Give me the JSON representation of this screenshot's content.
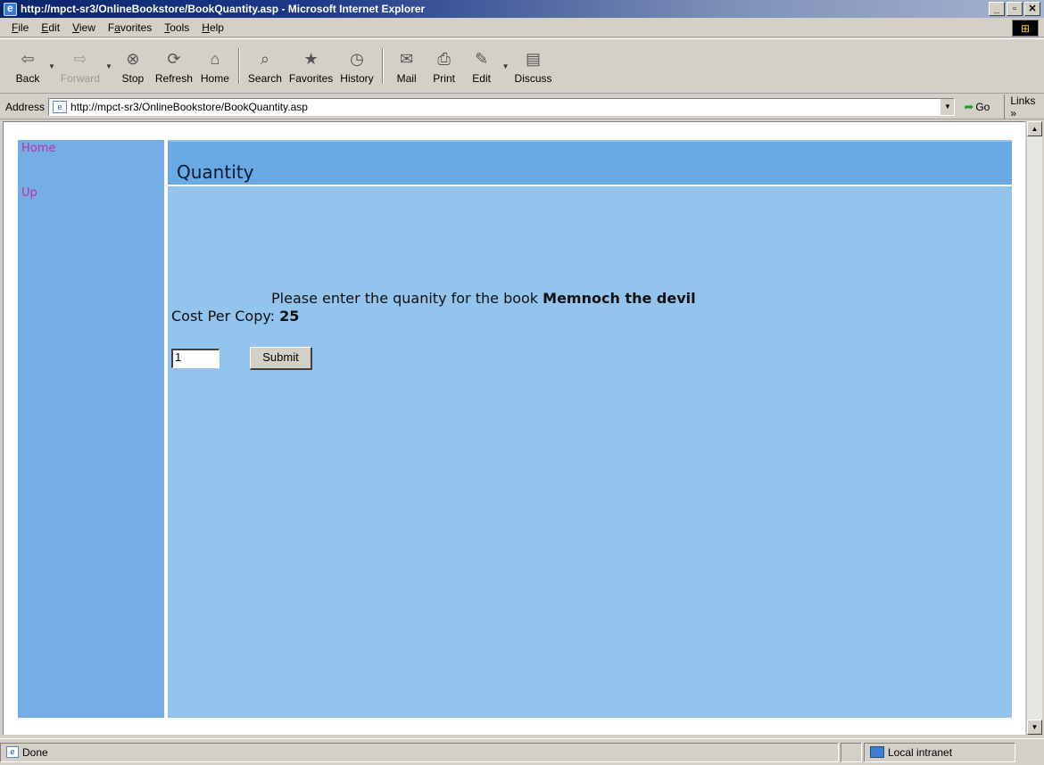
{
  "window": {
    "title": "http://mpct-sr3/OnlineBookstore/BookQuantity.asp - Microsoft Internet Explorer"
  },
  "menu": [
    {
      "pre": "",
      "ul": "F",
      "post": "ile"
    },
    {
      "pre": "",
      "ul": "E",
      "post": "dit"
    },
    {
      "pre": "",
      "ul": "V",
      "post": "iew"
    },
    {
      "pre": "F",
      "ul": "a",
      "post": "vorites"
    },
    {
      "pre": "",
      "ul": "T",
      "post": "ools"
    },
    {
      "pre": "",
      "ul": "H",
      "post": "elp"
    }
  ],
  "toolbar": {
    "back": "Back",
    "forward": "Forward",
    "stop": "Stop",
    "refresh": "Refresh",
    "home": "Home",
    "search": "Search",
    "favorites": "Favorites",
    "history": "History",
    "mail": "Mail",
    "print": "Print",
    "edit": "Edit",
    "discuss": "Discuss"
  },
  "address": {
    "label": "Address",
    "url": "http://mpct-sr3/OnlineBookstore/BookQuantity.asp",
    "go": "Go",
    "links": "Links »"
  },
  "nav": {
    "home": "Home",
    "up": "Up"
  },
  "page": {
    "title": "Quantity",
    "prompt_text": "Please enter the quanity for the book",
    "book_title": "Memnoch the devil",
    "cost_label": "Cost Per Copy:",
    "cost_value": "25",
    "quantity_value": "1",
    "submit_label": "Submit"
  },
  "status": {
    "text": "Done",
    "zone": "Local intranet"
  }
}
